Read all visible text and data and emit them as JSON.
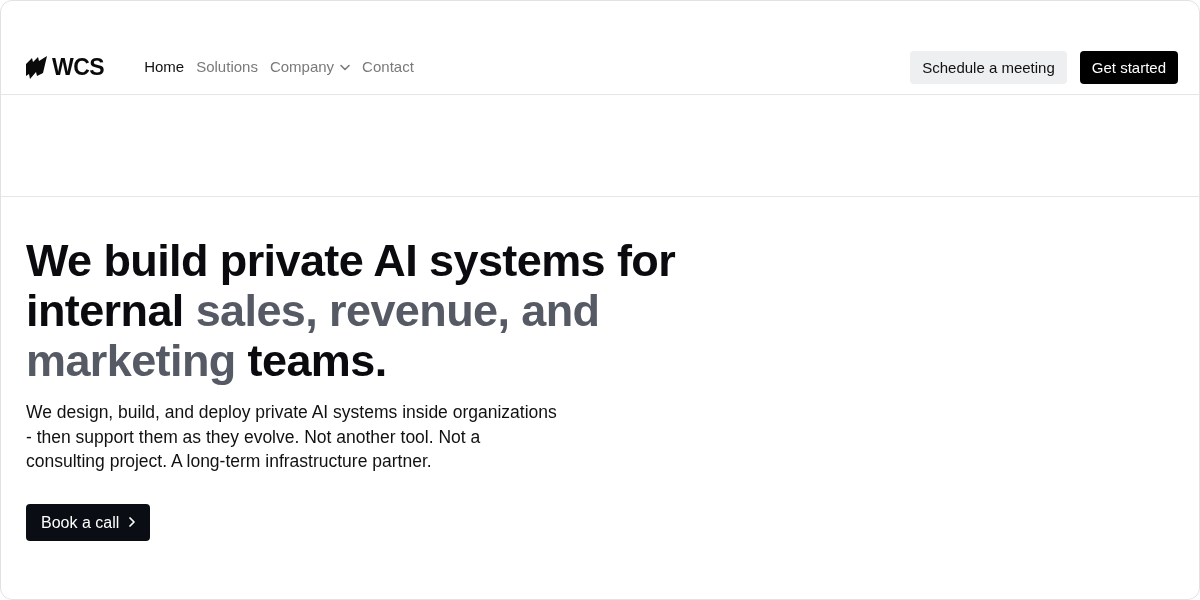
{
  "logo": {
    "text": "WCS"
  },
  "nav": [
    {
      "label": "Home",
      "selected": true,
      "kind": "link"
    },
    {
      "label": "Solutions",
      "selected": false,
      "kind": "link"
    },
    {
      "label": "Company",
      "selected": false,
      "kind": "dropdown"
    },
    {
      "label": "Contact",
      "selected": false,
      "kind": "link"
    }
  ],
  "header_buttons": [
    {
      "label": "Schedule a meeting",
      "kind": "secondary"
    },
    {
      "label": "Get started",
      "kind": "primary"
    }
  ],
  "hero": {
    "heading": [
      {
        "text": "We build private AI systems for internal ",
        "muted": false
      },
      {
        "text": "sales, revenue, and marketing",
        "muted": true
      },
      {
        "text": " teams.",
        "muted": false
      }
    ],
    "text": "We design, build, and deploy private AI systems inside organizations - then support them as they evolve. Not another tool. Not a consulting project. A long-term infrastructure partner.",
    "button": {
      "label": "Book a call"
    }
  }
}
